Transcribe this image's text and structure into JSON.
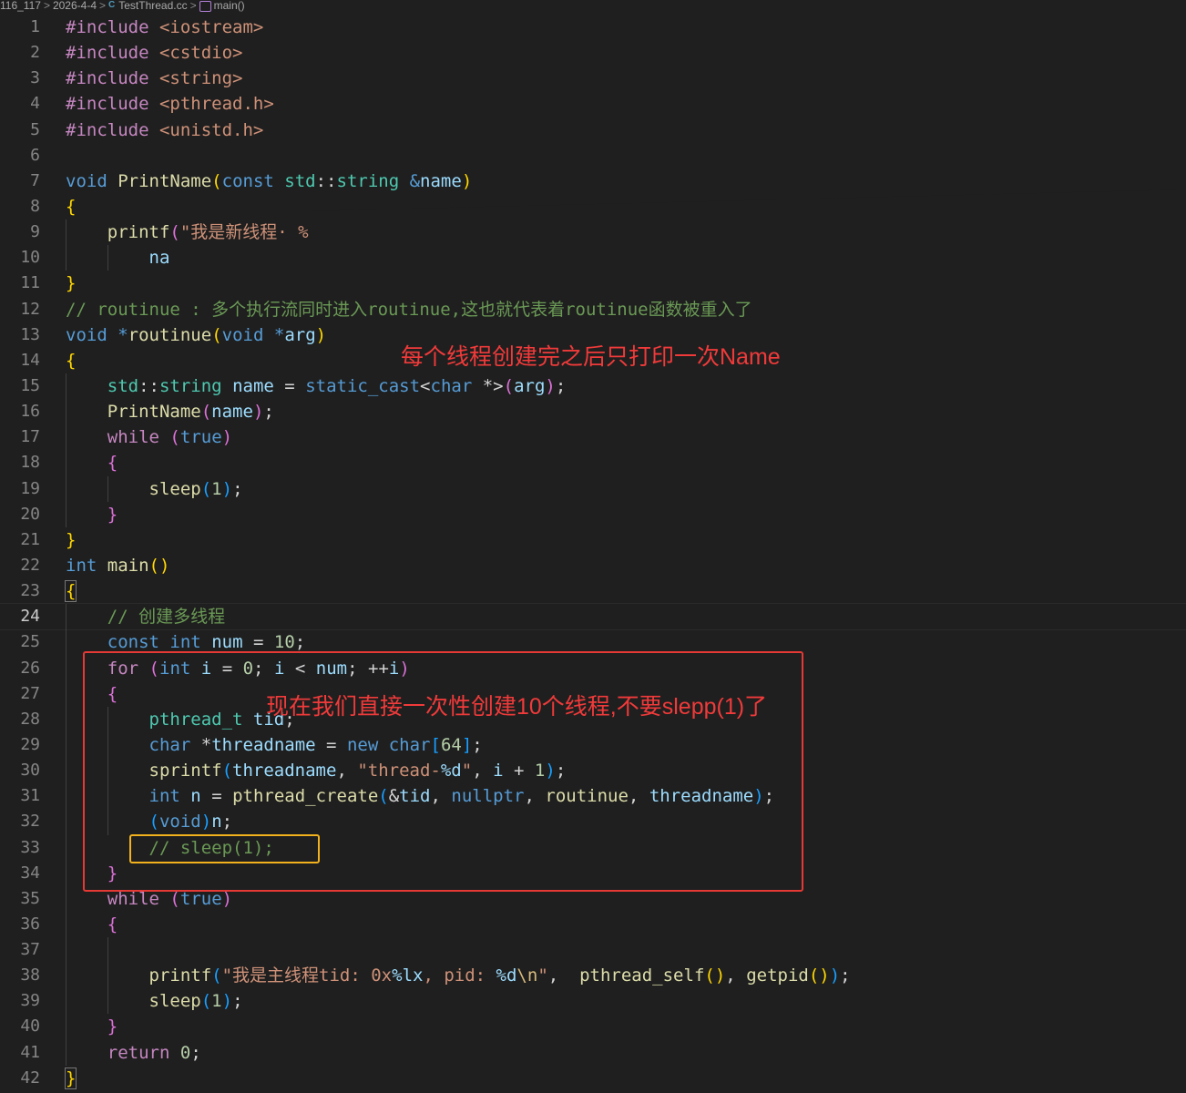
{
  "breadcrumb": {
    "items": [
      "116_117",
      "2026-4-4",
      "TestThread.cc",
      "main()"
    ],
    "file_icon": "C",
    "separator": ">"
  },
  "editor": {
    "active_line": 24,
    "lines": [
      {
        "n": "1"
      },
      {
        "n": "2"
      },
      {
        "n": "3"
      },
      {
        "n": "4"
      },
      {
        "n": "5"
      },
      {
        "n": "6"
      },
      {
        "n": "7"
      },
      {
        "n": "8"
      },
      {
        "n": "9"
      },
      {
        "n": "10"
      },
      {
        "n": "11"
      },
      {
        "n": "12"
      },
      {
        "n": "13"
      },
      {
        "n": "14"
      },
      {
        "n": "15"
      },
      {
        "n": "16"
      },
      {
        "n": "17"
      },
      {
        "n": "18"
      },
      {
        "n": "19"
      },
      {
        "n": "20"
      },
      {
        "n": "21"
      },
      {
        "n": "22"
      },
      {
        "n": "23"
      },
      {
        "n": "24"
      },
      {
        "n": "25"
      },
      {
        "n": "26"
      },
      {
        "n": "27"
      },
      {
        "n": "28"
      },
      {
        "n": "29"
      },
      {
        "n": "30"
      },
      {
        "n": "31"
      },
      {
        "n": "32"
      },
      {
        "n": "33"
      },
      {
        "n": "34"
      },
      {
        "n": "35"
      },
      {
        "n": "36"
      },
      {
        "n": "37"
      },
      {
        "n": "38"
      },
      {
        "n": "39"
      },
      {
        "n": "40"
      },
      {
        "n": "41"
      },
      {
        "n": "42"
      }
    ]
  },
  "annotations": {
    "top": "每个线程创建完之后只打印一次Name",
    "middle": "现在我们直接一次性创建10个线程,不要slepp(1)了"
  },
  "colors": {
    "background": "#1f1f1f",
    "box_red": "#e53935",
    "box_yellow": "#f2b21d",
    "annotation_text": "#f03a3a"
  }
}
